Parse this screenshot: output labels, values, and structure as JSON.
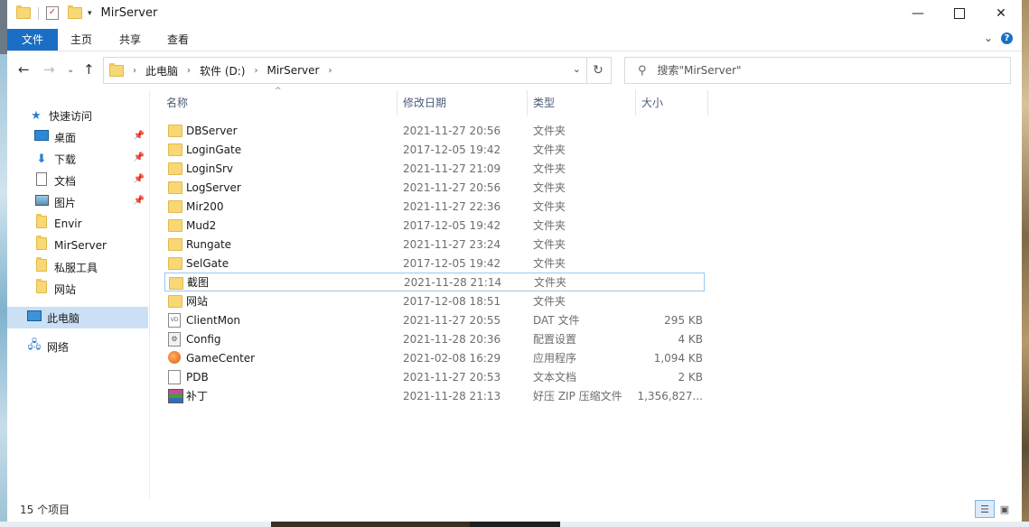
{
  "window": {
    "title": "MirServer"
  },
  "ribbon": {
    "tabs": [
      "文件",
      "主页",
      "共享",
      "查看"
    ]
  },
  "address": {
    "crumbs": [
      "此电脑",
      "软件 (D:)",
      "MirServer"
    ]
  },
  "search": {
    "placeholder": "搜索\"MirServer\""
  },
  "sidebar": {
    "items": [
      {
        "label": "快速访问",
        "icon": "star-icon"
      },
      {
        "label": "桌面",
        "icon": "desktop-icon",
        "pinned": true
      },
      {
        "label": "下载",
        "icon": "download-icon",
        "pinned": true
      },
      {
        "label": "文档",
        "icon": "document-icon",
        "pinned": true
      },
      {
        "label": "图片",
        "icon": "picture-icon",
        "pinned": true
      },
      {
        "label": "Envir",
        "icon": "folder-icon"
      },
      {
        "label": "MirServer",
        "icon": "folder-icon"
      },
      {
        "label": "私服工具",
        "icon": "folder-icon"
      },
      {
        "label": "网站",
        "icon": "folder-icon"
      },
      {
        "label": "此电脑",
        "icon": "computer-icon",
        "selected": true
      },
      {
        "label": "网络",
        "icon": "network-icon"
      }
    ]
  },
  "columns": {
    "name": "名称",
    "date": "修改日期",
    "type": "类型",
    "size": "大小"
  },
  "files": [
    {
      "name": "DBServer",
      "date": "2021-11-27 20:56",
      "type": "文件夹",
      "size": "",
      "icon": "folder-icon"
    },
    {
      "name": "LoginGate",
      "date": "2017-12-05 19:42",
      "type": "文件夹",
      "size": "",
      "icon": "folder-icon"
    },
    {
      "name": "LoginSrv",
      "date": "2021-11-27 21:09",
      "type": "文件夹",
      "size": "",
      "icon": "folder-icon"
    },
    {
      "name": "LogServer",
      "date": "2021-11-27 20:56",
      "type": "文件夹",
      "size": "",
      "icon": "folder-icon"
    },
    {
      "name": "Mir200",
      "date": "2021-11-27 22:36",
      "type": "文件夹",
      "size": "",
      "icon": "folder-icon"
    },
    {
      "name": "Mud2",
      "date": "2017-12-05 19:42",
      "type": "文件夹",
      "size": "",
      "icon": "folder-icon"
    },
    {
      "name": "Rungate",
      "date": "2021-11-27 23:24",
      "type": "文件夹",
      "size": "",
      "icon": "folder-icon"
    },
    {
      "name": "SelGate",
      "date": "2017-12-05 19:42",
      "type": "文件夹",
      "size": "",
      "icon": "folder-icon"
    },
    {
      "name": "截图",
      "date": "2021-11-28 21:14",
      "type": "文件夹",
      "size": "",
      "icon": "folder-icon",
      "highlighted": true
    },
    {
      "name": "网站",
      "date": "2017-12-08 18:51",
      "type": "文件夹",
      "size": "",
      "icon": "folder-icon"
    },
    {
      "name": "ClientMon",
      "date": "2021-11-27 20:55",
      "type": "DAT 文件",
      "size": "295 KB",
      "icon": "dat-file-icon"
    },
    {
      "name": "Config",
      "date": "2021-11-28 20:36",
      "type": "配置设置",
      "size": "4 KB",
      "icon": "config-file-icon"
    },
    {
      "name": "GameCenter",
      "date": "2021-02-08 16:29",
      "type": "应用程序",
      "size": "1,094 KB",
      "icon": "app-icon"
    },
    {
      "name": "PDB",
      "date": "2021-11-27 20:53",
      "type": "文本文档",
      "size": "2 KB",
      "icon": "text-file-icon"
    },
    {
      "name": "补丁",
      "date": "2021-11-28 21:13",
      "type": "好压 ZIP 压缩文件",
      "size": "1,356,827...",
      "icon": "zip-file-icon"
    }
  ],
  "status": {
    "count": "15 个项目"
  }
}
